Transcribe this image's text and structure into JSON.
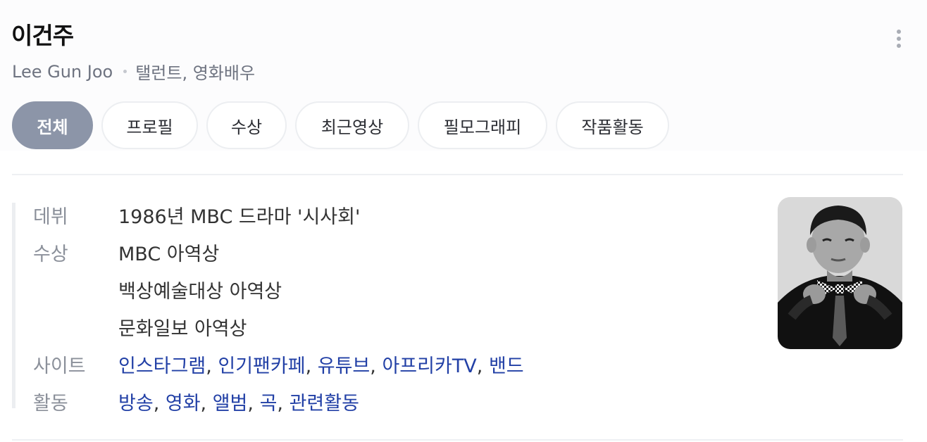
{
  "person": {
    "name": "이건주",
    "english_name": "Lee Gun Joo",
    "occupation": "탤런트, 영화배우"
  },
  "more_menu": {
    "icon": "more-vertical-icon"
  },
  "tabs": [
    {
      "label": "전체",
      "active": true
    },
    {
      "label": "프로필",
      "active": false
    },
    {
      "label": "수상",
      "active": false
    },
    {
      "label": "최근영상",
      "active": false
    },
    {
      "label": "필모그래피",
      "active": false
    },
    {
      "label": "작품활동",
      "active": false
    }
  ],
  "info": {
    "debut_label": "데뷔",
    "debut_value": "1986년 MBC 드라마 '시사회'",
    "awards_label": "수상",
    "awards": [
      "MBC 아역상",
      "백상예술대상 아역상",
      "문화일보 아역상"
    ],
    "sites_label": "사이트",
    "sites": [
      "인스타그램",
      "인기팬카페",
      "유튜브",
      "아프리카TV",
      "밴드"
    ],
    "activity_label": "활동",
    "activities": [
      "방송",
      "영화",
      "앨범",
      "곡",
      "관련활동"
    ],
    "separator": ", "
  },
  "photo": {
    "icon": "profile-photo",
    "style": "grayscale"
  },
  "colors": {
    "link": "#2240a6",
    "active_tab": "#8c95a8",
    "label": "#8b909a",
    "text": "#333333"
  }
}
